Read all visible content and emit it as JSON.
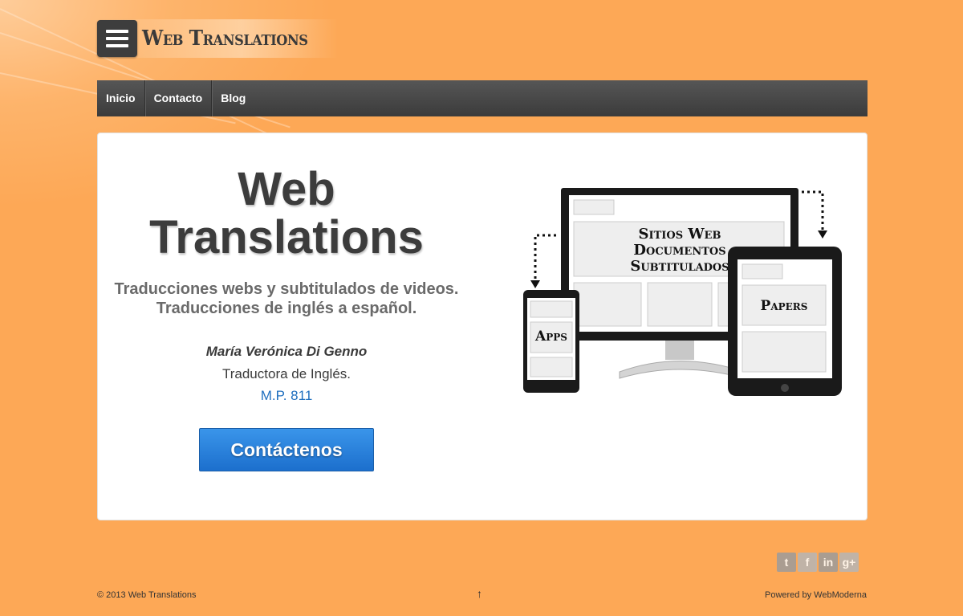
{
  "logo": {
    "text": "Web Translations"
  },
  "nav": {
    "items": [
      {
        "label": "Inicio"
      },
      {
        "label": "Contacto"
      },
      {
        "label": "Blog"
      }
    ]
  },
  "hero": {
    "title_line1": "Web",
    "title_line2": "Translations",
    "subtitle": "Traducciones webs y subtitulados de videos. Traducciones de inglés a español.",
    "name": "María Verónica Di Genno",
    "role": "Traductora de Inglés.",
    "registration": "M.P. 811",
    "cta_label": "Contáctenos"
  },
  "illustration": {
    "monitor_lines": [
      "Sitios Web",
      "Documentos",
      "Subtitulados"
    ],
    "phone_label": "Apps",
    "tablet_label": "Papers"
  },
  "social": {
    "icons": [
      "twitter-icon",
      "facebook-icon",
      "linkedin-icon",
      "google-plus-icon"
    ],
    "glyphs": [
      "t",
      "f",
      "in",
      "g+"
    ]
  },
  "footer": {
    "copyright": "© 2013 Web Translations",
    "up_arrow": "↑",
    "powered_prefix": "Powered by ",
    "powered_link": "WebModerna"
  },
  "colors": {
    "background": "#fda856",
    "nav": "#464646",
    "cta": "#2a82dc",
    "link": "#1f6fbf"
  }
}
